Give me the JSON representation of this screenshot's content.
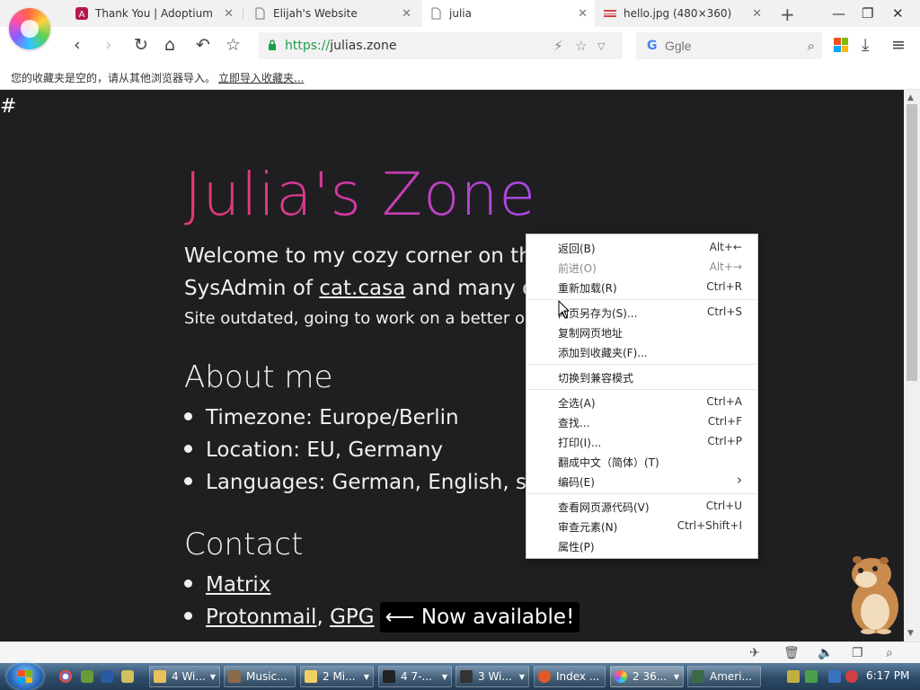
{
  "tabs": [
    {
      "title": "Thank You | Adoptium",
      "close": "✕"
    },
    {
      "title": "Elijah's Website",
      "close": "✕"
    },
    {
      "title": "julia",
      "close": "✕"
    },
    {
      "title": "hello.jpg (480×360)",
      "close": "✕"
    }
  ],
  "window": {
    "new_tab": "+",
    "minimize": "—",
    "restore": "❐",
    "close": "✕"
  },
  "toolbar": {
    "url_scheme": "https://",
    "url_host": "julias.zone",
    "search_engine": "G",
    "search_placeholder": "Ggle"
  },
  "bookmarks": {
    "message": "您的收藏夹是空的，请从其他浏览器导入。",
    "import_link": "立即导入收藏夹..."
  },
  "page": {
    "hash": "#",
    "title": "Julia's Zone",
    "welcome_line1": "Welcome to my cozy corner on th",
    "welcome_line2_prefix": "SysAdmin of ",
    "welcome_line2_link": "cat.casa",
    "welcome_line2_suffix": " and many o",
    "welcome_line3": "Site outdated, going to work on a better o",
    "about_heading": "About me",
    "about_items": [
      "Timezone: Europe/Berlin",
      "Location: EU, Germany",
      "Languages: German, English, so"
    ],
    "contact_heading": "Contact",
    "contact_matrix": "Matrix",
    "contact_protonmail": "Protonmail",
    "contact_comma": ",",
    "contact_gpg": "GPG",
    "contact_badge": "⟵ Now available!"
  },
  "context_menu": [
    {
      "label": "返回(B)",
      "shortcut": "Alt+←",
      "enabled": true
    },
    {
      "label": "前进(O)",
      "shortcut": "Alt+→",
      "enabled": false
    },
    {
      "label": "重新加载(R)",
      "shortcut": "Ctrl+R",
      "enabled": true
    },
    {
      "label": "网页另存为(S)...",
      "shortcut": "Ctrl+S",
      "enabled": true
    },
    {
      "label": "复制网页地址",
      "shortcut": "",
      "enabled": true
    },
    {
      "label": "添加到收藏夹(F)...",
      "shortcut": "",
      "enabled": true
    },
    {
      "label": "切换到兼容模式",
      "shortcut": "",
      "enabled": true
    },
    {
      "label": "全选(A)",
      "shortcut": "Ctrl+A",
      "enabled": true
    },
    {
      "label": "查找...",
      "shortcut": "Ctrl+F",
      "enabled": true
    },
    {
      "label": "打印(I)...",
      "shortcut": "Ctrl+P",
      "enabled": true
    },
    {
      "label": "翻成中文（简体）(T)",
      "shortcut": "",
      "enabled": true
    },
    {
      "label": "编码(E)",
      "shortcut": "›",
      "enabled": true
    },
    {
      "label": "查看网页源代码(V)",
      "shortcut": "Ctrl+U",
      "enabled": true
    },
    {
      "label": "审查元素(N)",
      "shortcut": "Ctrl+Shift+I",
      "enabled": true
    },
    {
      "label": "属性(P)",
      "shortcut": "",
      "enabled": true
    }
  ],
  "taskbar": {
    "items": [
      {
        "label": "4 Wi...",
        "color": "#e8c15a"
      },
      {
        "label": "Music...",
        "color": "#8a6a4a"
      },
      {
        "label": "2 Mi...",
        "color": "#f0d060"
      },
      {
        "label": "4 7-...",
        "color": "#222222"
      },
      {
        "label": "3 Wi...",
        "color": "#333333"
      },
      {
        "label": "Index ...",
        "color": "#e25a2a"
      },
      {
        "label": "2 36...",
        "color": "#ff6a3d"
      },
      {
        "label": "Ameri...",
        "color": "#3a6a4a"
      }
    ],
    "clock": "6:17 PM"
  }
}
